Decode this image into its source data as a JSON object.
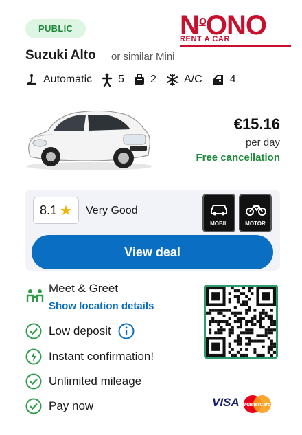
{
  "badge": {
    "label": "PUBLIC"
  },
  "logo": {
    "main_left": "N",
    "main_sup": "o",
    "main_right": "ONO",
    "sub": "RENT A CAR"
  },
  "car": {
    "name": "Suzuki Alto",
    "category": "or similar Mini"
  },
  "specs": [
    {
      "icon": "gear-shift-icon",
      "value": "Automatic"
    },
    {
      "icon": "seat-icon",
      "value": "5"
    },
    {
      "icon": "bag-icon",
      "value": "2"
    },
    {
      "icon": "snowflake-icon",
      "value": "A/C"
    },
    {
      "icon": "door-icon",
      "value": "4"
    }
  ],
  "pricing": {
    "price": "€15.16",
    "period": "per day",
    "cancellation": "Free cancellation"
  },
  "rating": {
    "score": "8.1",
    "label": "Very Good"
  },
  "partner_badges": [
    {
      "label": "MOBIL"
    },
    {
      "label": "MOTOR"
    }
  ],
  "cta": {
    "label": "View deal"
  },
  "pickup": {
    "type": "Meet & Greet",
    "link": "Show location details"
  },
  "features": [
    {
      "icon": "check-circle-icon",
      "label": "Low deposit"
    },
    {
      "icon": "lightning-circle-icon",
      "label": "Instant confirmation!"
    },
    {
      "icon": "check-circle-icon",
      "label": "Unlimited mileage"
    },
    {
      "icon": "check-circle-icon",
      "label": "Pay now"
    }
  ],
  "payment": {
    "visa": "VISA",
    "mastercard": "MasterCard"
  },
  "colors": {
    "accent": "#0a6fc2",
    "brand": "#c8102e",
    "success": "#1e8a3a",
    "badge_bg": "#dff5e3"
  }
}
